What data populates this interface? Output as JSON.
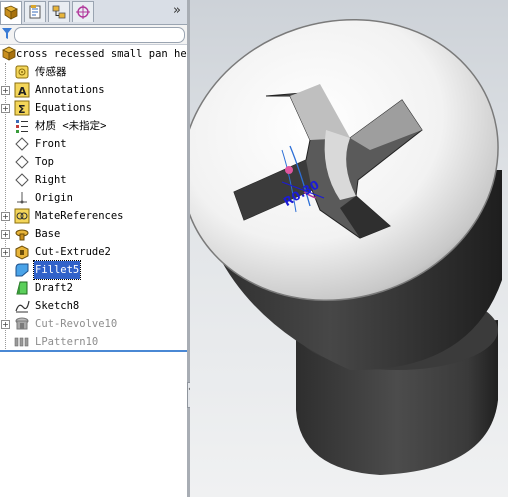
{
  "tabs": [
    {
      "name": "feature-manager",
      "icon": "feature-tree-icon"
    },
    {
      "name": "property-manager",
      "icon": "property-sheet-icon"
    },
    {
      "name": "configuration-manager",
      "icon": "configuration-icon"
    },
    {
      "name": "dimxpert-manager",
      "icon": "target-crosshair-icon"
    }
  ],
  "expand_label": "»",
  "tree": {
    "root": "cross recessed small pan head",
    "items": [
      {
        "label": "传感器",
        "icon": "sensor-icon",
        "expandable": false
      },
      {
        "label": "Annotations",
        "icon": "annotations-icon",
        "expandable": true
      },
      {
        "label": "Equations",
        "icon": "equations-sigma-icon",
        "expandable": true
      },
      {
        "label": "材质 <未指定>",
        "icon": "material-icon",
        "expandable": false
      },
      {
        "label": "Front",
        "icon": "plane-icon",
        "expandable": false
      },
      {
        "label": "Top",
        "icon": "plane-icon",
        "expandable": false
      },
      {
        "label": "Right",
        "icon": "plane-icon",
        "expandable": false
      },
      {
        "label": "Origin",
        "icon": "origin-icon",
        "expandable": false
      },
      {
        "label": "MateReferences",
        "icon": "mate-references-icon",
        "expandable": true
      },
      {
        "label": "Base",
        "icon": "boss-revolve-icon",
        "expandable": true
      },
      {
        "label": "Cut-Extrude2",
        "icon": "cut-extrude-icon",
        "expandable": true
      },
      {
        "label": "Fillet5",
        "icon": "fillet-icon",
        "expandable": false,
        "selected": true
      },
      {
        "label": "Draft2",
        "icon": "draft-icon",
        "expandable": false
      },
      {
        "label": "Sketch8",
        "icon": "sketch-icon",
        "expandable": false
      },
      {
        "label": "Cut-Revolve10",
        "icon": "cut-revolve-icon",
        "expandable": true,
        "suppressed": true
      },
      {
        "label": "LPattern10",
        "icon": "linear-pattern-icon",
        "expandable": false,
        "suppressed": true
      }
    ]
  },
  "viewport": {
    "dimension_label": "R0.30"
  },
  "colors": {
    "selection": "#3162c9",
    "splitter": "#4a88d4",
    "dimension": "#1b1bd6",
    "suppressed_text": "#8d8d8d"
  }
}
